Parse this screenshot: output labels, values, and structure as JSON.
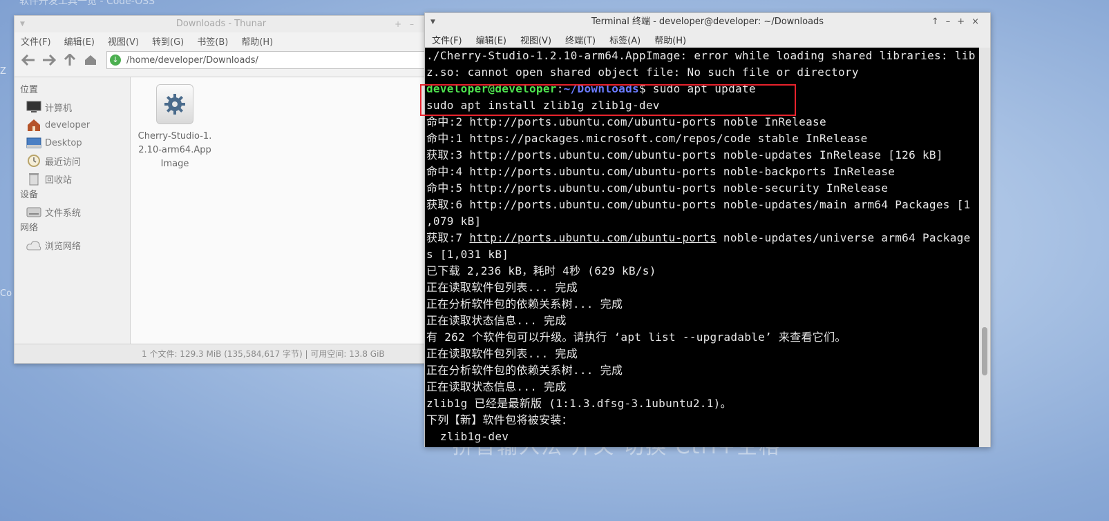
{
  "desktop": {
    "top_text": "软件开发工具一览 - Code-OSS",
    "bottom_text": "拼音输入法 开关 切换 Ctrl+空格",
    "left_text_1": "Co",
    "left_text_2": "Z"
  },
  "thunar": {
    "title": "Downloads - Thunar",
    "menu": [
      "文件(F)",
      "编辑(E)",
      "视图(V)",
      "转到(G)",
      "书签(B)",
      "帮助(H)"
    ],
    "address": "/home/developer/Downloads/",
    "sidebar": {
      "places_heading": "位置",
      "places": [
        "计算机",
        "developer",
        "Desktop",
        "最近访问",
        "回收站"
      ],
      "devices_heading": "设备",
      "devices": [
        "文件系统"
      ],
      "network_heading": "网络",
      "network": [
        "浏览网络"
      ]
    },
    "file": {
      "name": "Cherry-Studio-1.2.10-arm64.AppImage"
    },
    "status": "1 个文件: 129.3 MiB (135,584,617 字节)  |  可用空间: 13.8 GiB"
  },
  "terminal": {
    "title": "Terminal 终端 - developer@developer: ~/Downloads",
    "menu": [
      "文件(F)",
      "编辑(E)",
      "视图(V)",
      "终端(T)",
      "标签(A)",
      "帮助(H)"
    ],
    "prompt_user": "developer@developer",
    "prompt_sep": ":",
    "prompt_path": "~/Downloads",
    "prompt_cmd": "$ sudo apt update",
    "line_01": "./Cherry-Studio-1.2.10-arm64.AppImage: error while loading shared libraries: lib",
    "line_02": "z.so: cannot open shared object file: No such file or directory",
    "line_04": "sudo apt install zlib1g zlib1g-dev",
    "line_05": "命中:2 http://ports.ubuntu.com/ubuntu-ports noble InRelease",
    "line_06": "命中:1 https://packages.microsoft.com/repos/code stable InRelease",
    "line_07": "获取:3 http://ports.ubuntu.com/ubuntu-ports noble-updates InRelease [126 kB]",
    "line_08": "命中:4 http://ports.ubuntu.com/ubuntu-ports noble-backports InRelease",
    "line_09": "命中:5 http://ports.ubuntu.com/ubuntu-ports noble-security InRelease",
    "line_10": "获取:6 http://ports.ubuntu.com/ubuntu-ports noble-updates/main arm64 Packages [1",
    "line_11": ",079 kB]",
    "line_12a": "获取:7 ",
    "line_12b": "http://ports.ubuntu.com/ubuntu-ports",
    "line_12c": " noble-updates/universe arm64 Package",
    "line_13": "s [1,031 kB]",
    "line_14": "已下载 2,236 kB，耗时 4秒 (629 kB/s)",
    "line_15": "正在读取软件包列表... 完成",
    "line_16": "正在分析软件包的依赖关系树... 完成",
    "line_17": "正在读取状态信息... 完成",
    "line_18": "有 262 个软件包可以升级。请执行 ‘apt list --upgradable’ 来查看它们。",
    "line_19": "正在读取软件包列表... 完成",
    "line_20": "正在分析软件包的依赖关系树... 完成",
    "line_21": "正在读取状态信息... 完成",
    "line_22": "zlib1g 已经是最新版 (1:1.3.dfsg-3.1ubuntu2.1)。",
    "line_23": "下列【新】软件包将被安装：",
    "line_24": "  zlib1g-dev"
  }
}
